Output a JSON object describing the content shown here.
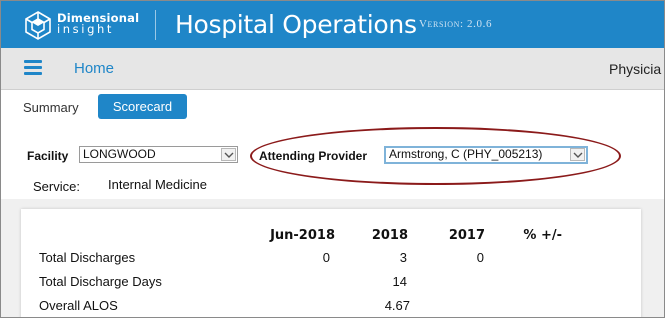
{
  "header": {
    "brand_line1": "Dimensional",
    "brand_line2": "insight",
    "app_title": "Hospital Operations",
    "version": "Version: 2.0.6",
    "color": "#1f86c8"
  },
  "navbar": {
    "menu_icon": "hamburger-icon",
    "home": "Home",
    "physician_truncated": "Physicia"
  },
  "tabs": [
    {
      "label": "Summary",
      "active": false
    },
    {
      "label": "Scorecard",
      "active": true
    }
  ],
  "filters": {
    "facility_label": "Facility",
    "facility_value": "LONGWOOD",
    "provider_label": "Attending Provider",
    "provider_value": "Armstrong, C (PHY_005213)",
    "service_label": "Service:",
    "service_value": "Internal Medicine"
  },
  "table": {
    "columns": [
      "Jun-2018",
      "2018",
      "2017",
      "% +/-"
    ],
    "rows": [
      {
        "label": "Total Discharges",
        "values": [
          "0",
          "3",
          "0",
          ""
        ]
      },
      {
        "label": "Total Discharge Days",
        "values": [
          "",
          "14",
          "",
          ""
        ]
      },
      {
        "label": "Overall ALOS",
        "values": [
          "",
          "4.67",
          "",
          ""
        ]
      }
    ]
  }
}
